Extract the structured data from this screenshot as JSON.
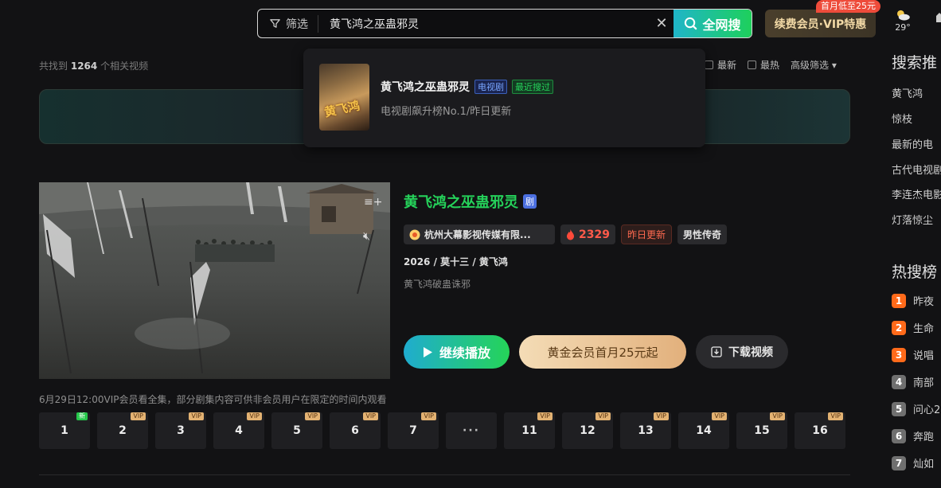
{
  "search": {
    "filter_label": "筛选",
    "query": "黄飞鸿之巫蛊邪灵",
    "submit_label": "全网搜"
  },
  "vip": {
    "button_label": "续费会员·VIP特惠",
    "promo_tag": "首月低至25元"
  },
  "weather": {
    "temp": "29°"
  },
  "results": {
    "count_prefix": "共找到",
    "count": "1264",
    "count_suffix": "个相关视频",
    "sort": {
      "latest": "最新",
      "hottest": "最热",
      "advanced": "高级筛选"
    }
  },
  "suggestion": {
    "title": "黄飞鸿之巫蛊邪灵",
    "tag_type": "电视剧",
    "tag_recent": "最近搜过",
    "subtitle": "电视剧飙升榜No.1/昨日更新",
    "poster_text": "黄飞鸿"
  },
  "right_panel": {
    "search_recommend_title": "搜索推",
    "recommend_items": [
      "黄飞鸿",
      "惊枝",
      "最新的电",
      "古代电视剧",
      "李连杰电影",
      "灯落惊尘"
    ],
    "hot_title": "热搜榜",
    "hot_items": [
      {
        "rank": "1",
        "label": "昨夜",
        "color": "#ff6a1a"
      },
      {
        "rank": "2",
        "label": "生命",
        "color": "#ff6a1a"
      },
      {
        "rank": "3",
        "label": "说唱",
        "color": "#ff6a1a"
      },
      {
        "rank": "4",
        "label": "南部",
        "color": "#6f6f6f"
      },
      {
        "rank": "5",
        "label": "问心2",
        "color": "#6f6f6f"
      },
      {
        "rank": "6",
        "label": "奔跑",
        "color": "#6f6f6f"
      },
      {
        "rank": "7",
        "label": "灿如",
        "color": "#6f6f6f"
      }
    ]
  },
  "main_result": {
    "title": "黄飞鸿之巫蛊邪灵",
    "type_badge": "剧",
    "producer": "杭州大幕影视传媒有限...",
    "heat": "2329",
    "update_tag": "昨日更新",
    "genre_tag": "男性传奇",
    "meta": "2026 / 莫十三 / 黄飞鸿",
    "description": "黄飞鸿破蛊诛邪",
    "play_label": "继续播放",
    "vip_label": "黄金会员首月25元起",
    "download_label": "下载视频",
    "notice": "6月29日12:00VIP会员看全集，部分剧集内容可供非会员用户在限定的时间内观看"
  },
  "episodes": [
    {
      "label": "1",
      "badge": "新",
      "kind": "new"
    },
    {
      "label": "2",
      "badge": "VIP",
      "kind": "vip"
    },
    {
      "label": "3",
      "badge": "VIP",
      "kind": "vip"
    },
    {
      "label": "4",
      "badge": "VIP",
      "kind": "vip"
    },
    {
      "label": "5",
      "badge": "VIP",
      "kind": "vip"
    },
    {
      "label": "6",
      "badge": "VIP",
      "kind": "vip"
    },
    {
      "label": "7",
      "badge": "VIP",
      "kind": "vip"
    },
    {
      "label": "···",
      "badge": "",
      "kind": "more"
    },
    {
      "label": "11",
      "badge": "VIP",
      "kind": "vip"
    },
    {
      "label": "12",
      "badge": "VIP",
      "kind": "vip"
    },
    {
      "label": "13",
      "badge": "VIP",
      "kind": "vip"
    },
    {
      "label": "14",
      "badge": "VIP",
      "kind": "vip"
    },
    {
      "label": "15",
      "badge": "VIP",
      "kind": "vip"
    },
    {
      "label": "16",
      "badge": "VIP",
      "kind": "vip"
    }
  ]
}
